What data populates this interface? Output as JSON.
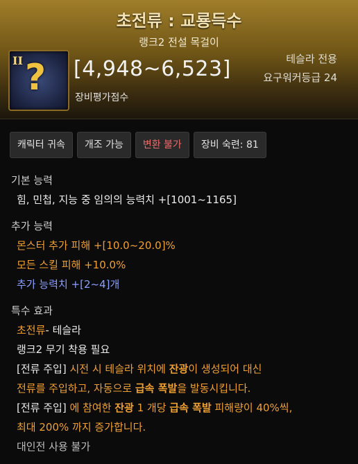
{
  "header": {
    "title": "초전류 : 교룡득수",
    "subtitle": "랭크2 전설 목걸이",
    "icon_rank": "II",
    "icon_symbol": "?",
    "score": "[4,948~6,523]",
    "score_label": "장비평가점수",
    "class_only": "테슬라 전용",
    "required_level": "요구워커등급 24"
  },
  "tags": [
    {
      "label": "캐릭터 귀속"
    },
    {
      "label": "개조 가능"
    },
    {
      "label": "변환 불가"
    },
    {
      "label": "장비 숙련: 81"
    }
  ],
  "basic": {
    "title": "기본 능력",
    "line": "힘, 민첩, 지능 중 임의의 능력치 +[1001~1165]"
  },
  "additional": {
    "title": "추가 능력",
    "lines": [
      "몬스터 추가 피해  +[10.0~20.0]%",
      "모든 스킬 피해  +10.0%",
      "추가 능력치 +[2~4]개"
    ]
  },
  "special": {
    "title": "특수 효과",
    "name": "초전류",
    "name_suffix": "- 테슬라",
    "req": "랭크2 무기 착용 필요",
    "e1_tag": "[전류 주입]",
    "e1_a": " 시전 시 테슬라 위치에 ",
    "e1_hl1": "잔광",
    "e1_b": "이 생성되어 대신",
    "e1_c": "전류를 주입하고, 자동으로 ",
    "e1_hl2": "급속 폭발",
    "e1_d": "을 발동시킵니다.",
    "e2_tag": "[전류 주입]",
    "e2_a": " 에 참여한 ",
    "e2_hl1": "잔광",
    "e2_b": " 1 개당 ",
    "e2_hl2": "급속 폭발",
    "e2_c": " 피해량",
    "e2_d": "이 40%씩,",
    "e2_e": "최대 200% 까지 증가합니다.",
    "pvp": "대인전 사용 불가"
  },
  "colors": {
    "header_gold": "#a07e2a",
    "accent_orange": "#f0a030",
    "tag_red": "#e96b6b",
    "stat_blue": "#8ba0ff"
  }
}
